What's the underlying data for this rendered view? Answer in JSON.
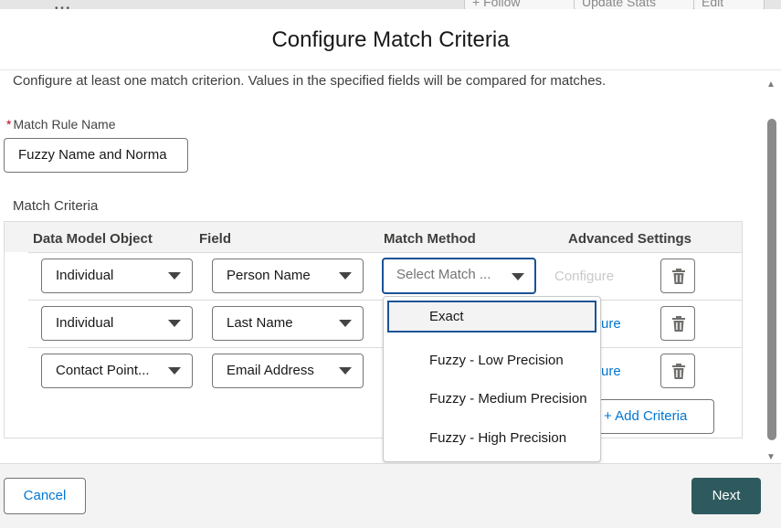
{
  "background": {
    "buttons": [
      "+ Follow",
      "Update Stats",
      "Edit"
    ]
  },
  "modal": {
    "title": "Configure Match Criteria",
    "intro": "Configure at least one match criterion. Values in the specified fields will be compared for matches.",
    "rule_name": {
      "label": "Match Rule Name",
      "required_mark": "*",
      "value": "Fuzzy Name and Norma"
    },
    "criteria_label": "Match Criteria",
    "columns": [
      "Data Model Object",
      "Field",
      "Match Method",
      "Advanced Settings"
    ],
    "rows": [
      {
        "object": "Individual",
        "field": "Person Name",
        "method": "Select Match ...",
        "configure": "Configure",
        "configure_enabled": false
      },
      {
        "object": "Individual",
        "field": "Last Name",
        "method": "",
        "configure": "ure",
        "configure_enabled": true
      },
      {
        "object": "Contact Point...",
        "field": "Email Address",
        "method": "",
        "configure": "ure",
        "configure_enabled": true
      }
    ],
    "add_criteria": "+ Add Criteria",
    "dropdown": {
      "options": [
        "Exact",
        "Fuzzy - Low Precision",
        "Fuzzy - Medium Precision",
        "Fuzzy - High Precision"
      ],
      "highlighted": "Exact"
    },
    "footer": {
      "cancel": "Cancel",
      "next": "Next"
    }
  },
  "colors": {
    "brand_button": "#2e5a5f",
    "focus_border": "#1b5297",
    "link": "#0176d3",
    "required": "#ba0517"
  },
  "icons": [
    "trash-icon",
    "chevron-down-icon",
    "scroll-up-icon",
    "scroll-down-icon"
  ]
}
